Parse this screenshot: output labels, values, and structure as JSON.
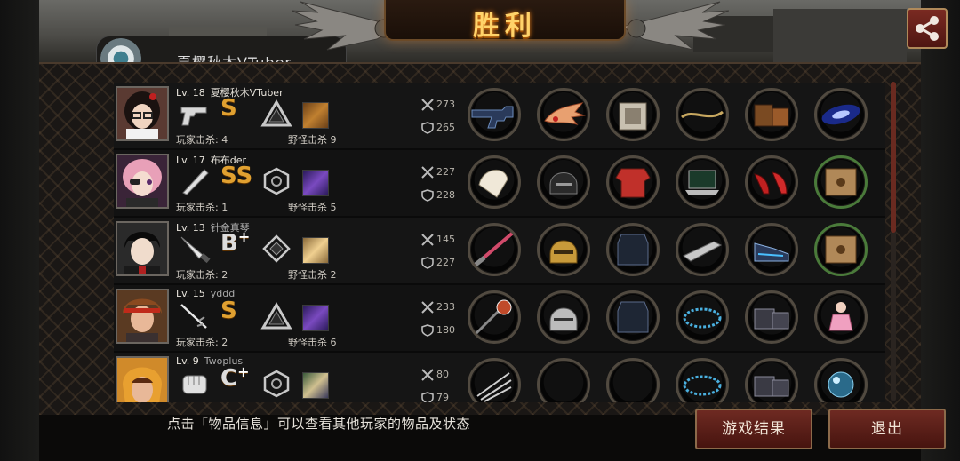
{
  "header": {
    "title": "胜利",
    "previous_tab_label": "夏樱秋木VTuber"
  },
  "footer": {
    "hint": "点击「物品信息」可以查看其他玩家的物品及状态",
    "result_button": "游戏结果",
    "exit_button": "退出"
  },
  "labels": {
    "player_kills": "玩家击杀",
    "monster_kills": "野怪击杀"
  },
  "colors": {
    "title": "#ffd36a",
    "button": "#6e2a22",
    "rank": "#e0a030"
  },
  "players": [
    {
      "level": "Lv. 18",
      "name": "夏樱秋木VTuber",
      "name_dim": false,
      "rank": "S",
      "rank_plus": "",
      "player_kills": "玩家击杀: 4",
      "monster_kills": "野怪击杀 9",
      "attack": "273",
      "defense": "265",
      "weapon_icon": "pistol-icon",
      "emblem_icon": "triangle-emblem-icon"
    },
    {
      "level": "Lv. 17",
      "name": "布布der",
      "name_dim": false,
      "rank": "SS",
      "rank_plus": "",
      "player_kills": "玩家击杀: 1",
      "monster_kills": "野怪击杀 5",
      "attack": "227",
      "defense": "228",
      "weapon_icon": "bat-icon",
      "emblem_icon": "hexagon-emblem-icon"
    },
    {
      "level": "Lv. 13",
      "name": "针金真琴",
      "name_dim": true,
      "rank": "B",
      "rank_plus": "+",
      "player_kills": "玩家击杀: 2",
      "monster_kills": "野怪击杀 2",
      "attack": "145",
      "defense": "227",
      "weapon_icon": "knife-icon",
      "emblem_icon": "diamond-emblem-icon"
    },
    {
      "level": "Lv. 15",
      "name": "yddd",
      "name_dim": true,
      "rank": "S",
      "rank_plus": "",
      "player_kills": "玩家击杀: 2",
      "monster_kills": "野怪击杀 6",
      "attack": "233",
      "defense": "180",
      "weapon_icon": "rapier-icon",
      "emblem_icon": "triangle-emblem-icon"
    },
    {
      "level": "Lv. 9",
      "name": "Twoplus",
      "name_dim": true,
      "rank": "C",
      "rank_plus": "+",
      "player_kills": "",
      "monster_kills": "",
      "attack": "80",
      "defense": "79",
      "weapon_icon": "glove-icon",
      "emblem_icon": "hexagon-emblem-icon"
    }
  ]
}
